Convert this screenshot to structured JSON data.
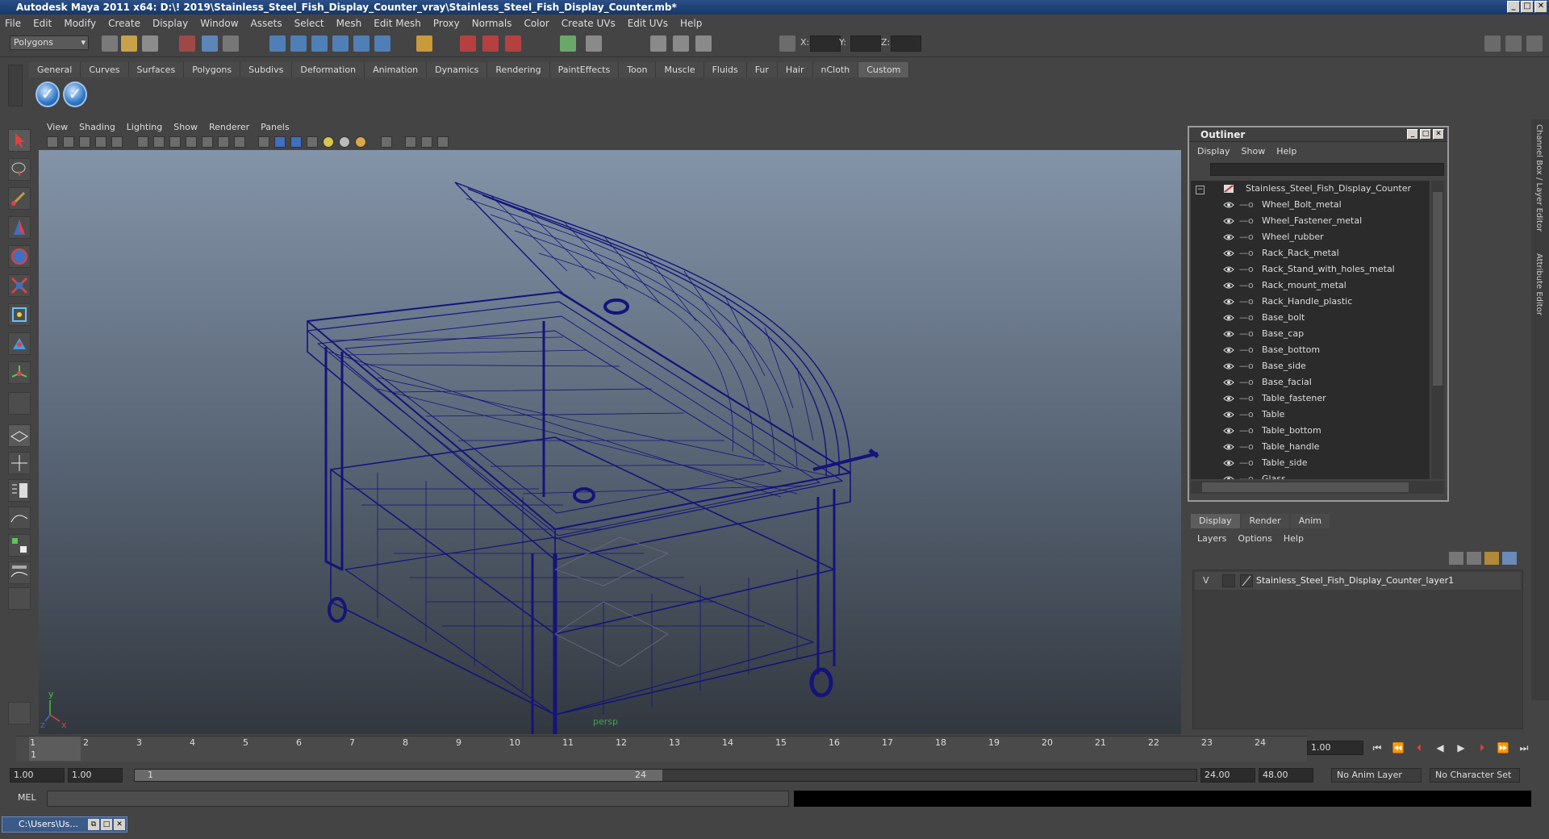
{
  "title": "Autodesk Maya 2011 x64: D:\\! 2019\\Stainless_Steel_Fish_Display_Counter_vray\\Stainless_Steel_Fish_Display_Counter.mb*",
  "window_buttons": [
    "_",
    "□",
    "✕"
  ],
  "menus": [
    "File",
    "Edit",
    "Modify",
    "Create",
    "Display",
    "Window",
    "Assets",
    "Select",
    "Mesh",
    "Edit Mesh",
    "Proxy",
    "Normals",
    "Color",
    "Create UVs",
    "Edit UVs",
    "Help"
  ],
  "status_line": {
    "mode": "Polygons",
    "x_label": "X:",
    "y_label": "Y:",
    "z_label": "Z:"
  },
  "shelf": {
    "tabs": [
      "General",
      "Curves",
      "Surfaces",
      "Polygons",
      "Subdivs",
      "Deformation",
      "Animation",
      "Dynamics",
      "Rendering",
      "PaintEffects",
      "Toon",
      "Muscle",
      "Fluids",
      "Fur",
      "Hair",
      "nCloth",
      "Custom"
    ],
    "active_tab": "Custom"
  },
  "viewport": {
    "menus": [
      "View",
      "Shading",
      "Lighting",
      "Show",
      "Renderer",
      "Panels"
    ],
    "camera_label": "persp",
    "axis_y": "y",
    "axis_x": "x",
    "axis_z": "z",
    "wire_color": "#14147a"
  },
  "outliner": {
    "title": "Outliner",
    "menus": [
      "Display",
      "Show",
      "Help"
    ],
    "items": [
      "Stainless_Steel_Fish_Display_Counter",
      "Wheel_Bolt_metal",
      "Wheel_Fastener_metal",
      "Wheel_rubber",
      "Rack_Rack_metal",
      "Rack_Stand_with_holes_metal",
      "Rack_mount_metal",
      "Rack_Handle_plastic",
      "Base_bolt",
      "Base_cap",
      "Base_bottom",
      "Base_side",
      "Base_facial",
      "Table_fastener",
      "Table",
      "Table_bottom",
      "Table_handle",
      "Table_side",
      "Glass"
    ]
  },
  "layer_editor": {
    "tabs": [
      "Display",
      "Render",
      "Anim"
    ],
    "active_tab": "Display",
    "menus": [
      "Layers",
      "Options",
      "Help"
    ],
    "layer_visibility": "V",
    "layer_name": "Stainless_Steel_Fish_Display_Counter_layer1"
  },
  "right_dock": {
    "channel_box": "Channel Box / Layer Editor",
    "attribute_editor": "Attribute Editor"
  },
  "timeline": {
    "frames": [
      "1",
      "2",
      "3",
      "4",
      "5",
      "6",
      "7",
      "8",
      "9",
      "10",
      "11",
      "12",
      "13",
      "14",
      "15",
      "16",
      "17",
      "18",
      "19",
      "20",
      "21",
      "22",
      "23",
      "24"
    ],
    "current_frame": "1.00",
    "playhead_label": "1"
  },
  "range": {
    "start": "1.00",
    "range_start": "1.00",
    "slider_start": "1",
    "slider_end": "24",
    "range_end": "24.00",
    "end": "48.00",
    "anim_layer": "No Anim Layer",
    "character_set": "No Character Set"
  },
  "command_line": {
    "label": "MEL"
  },
  "taskbar": {
    "minimized_window": "C:\\Users\\Us..."
  }
}
